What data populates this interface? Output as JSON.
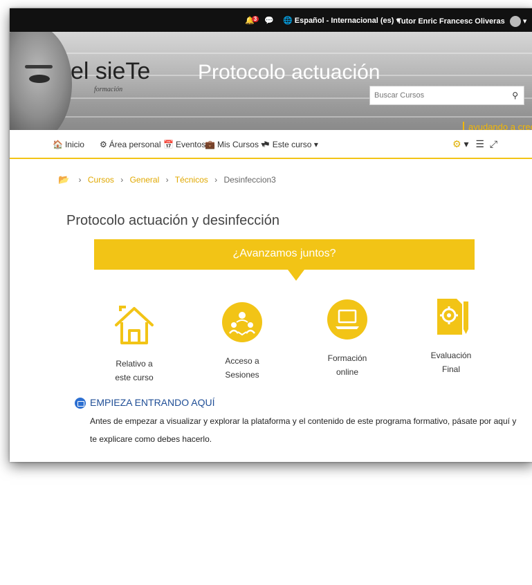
{
  "topbar": {
    "notification_count": "3",
    "language": "Español - Internacional (es)",
    "user": "Tutor Enric Francesc Oliveras"
  },
  "banner": {
    "logo_text": "el sieTe",
    "logo_sub": "formación",
    "title": "Protocolo actuación",
    "search_placeholder": "Buscar Cursos",
    "tagline": "ayudando a crecer"
  },
  "nav": {
    "items": [
      {
        "label": "Inicio"
      },
      {
        "label": "Área personal"
      },
      {
        "label": "Eventos"
      },
      {
        "label": "Mis Cursos"
      },
      {
        "label": "Este curso"
      }
    ]
  },
  "breadcrumb": {
    "items": [
      "Cursos",
      "General",
      "Técnicos"
    ],
    "current": "Desinfeccion3"
  },
  "course": {
    "title": "Protocolo actuación y desinfección"
  },
  "callout": {
    "text": "¿Avanzamos juntos?"
  },
  "tiles": [
    {
      "line1": "Relativo a",
      "line2": "este curso",
      "icon": "house-icon"
    },
    {
      "line1": "Acceso a",
      "line2": "Sesiones",
      "icon": "people-icon"
    },
    {
      "line1": "Formación",
      "line2": "online",
      "icon": "laptop-icon"
    },
    {
      "line1": "Evaluación",
      "line2": "Final",
      "icon": "evaluation-icon"
    }
  ],
  "section": {
    "heading": "EMPIEZA ENTRANDO AQUÍ",
    "body": "Antes de empezar a visualizar y explorar la plataforma y el contenido de este programa formativo, pásate por aquí y te explicare como debes hacerlo."
  },
  "colors": {
    "accent": "#f2c416",
    "link": "#e0a800",
    "section_blue": "#1f4e96"
  }
}
